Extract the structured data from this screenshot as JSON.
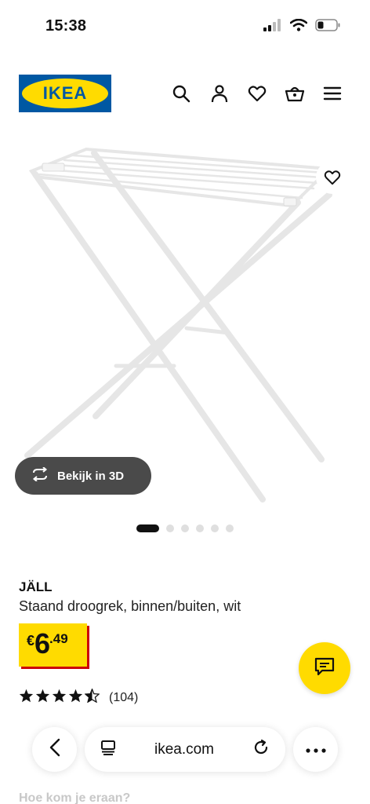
{
  "status_bar": {
    "time": "15:38"
  },
  "header": {
    "logo_text": "IKEA",
    "brand_colors": {
      "blue": "#0058a3",
      "yellow": "#ffdb00"
    }
  },
  "gallery": {
    "view_3d_label": "Bekijk in 3D",
    "dots_total": 6,
    "active_index": 0
  },
  "product": {
    "name": "JÄLL",
    "description": "Staand droogrek, binnen/buiten, wit",
    "price": {
      "currency": "€",
      "integer": "6",
      "decimal": ".49"
    },
    "rating": {
      "stars": 4.5,
      "count": "(104)"
    }
  },
  "browser": {
    "url": "ikea.com"
  },
  "below_fold_text": "Hoe kom je eraan?"
}
